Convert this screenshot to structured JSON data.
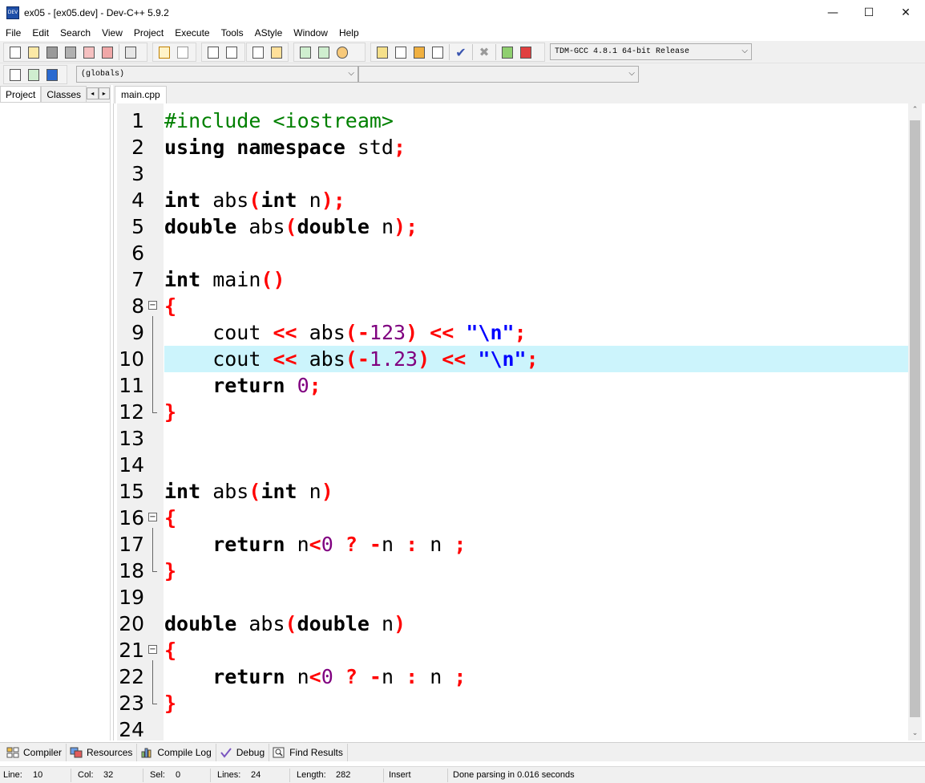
{
  "window": {
    "title": "ex05 - [ex05.dev] - Dev-C++ 5.9.2",
    "icon_label": "DEV",
    "minimize_glyph": "—",
    "maximize_glyph": "☐",
    "close_glyph": "✕"
  },
  "menu": [
    "File",
    "Edit",
    "Search",
    "View",
    "Project",
    "Execute",
    "Tools",
    "AStyle",
    "Window",
    "Help"
  ],
  "toolbar": {
    "compiler_select": "TDM-GCC 4.8.1 64-bit Release",
    "scope_select": "(globals)",
    "member_select": ""
  },
  "left_panel": {
    "tabs": [
      "Project",
      "Classes"
    ],
    "arrow_left": "◂",
    "arrow_right": "▸"
  },
  "editor": {
    "tab": "main.cpp",
    "highlighted_line": 10,
    "lines": [
      {
        "n": "1",
        "tokens": [
          {
            "t": "#include <iostream>",
            "c": "pp"
          }
        ]
      },
      {
        "n": "2",
        "tokens": [
          {
            "t": "using namespace",
            "c": "kw"
          },
          {
            "t": " std",
            "c": ""
          },
          {
            "t": ";",
            "c": "sym"
          }
        ]
      },
      {
        "n": "3",
        "tokens": []
      },
      {
        "n": "4",
        "tokens": [
          {
            "t": "int",
            "c": "kw"
          },
          {
            "t": " abs",
            "c": ""
          },
          {
            "t": "(",
            "c": "sym"
          },
          {
            "t": "int",
            "c": "kw"
          },
          {
            "t": " n",
            "c": ""
          },
          {
            "t": ");",
            "c": "sym"
          }
        ]
      },
      {
        "n": "5",
        "tokens": [
          {
            "t": "double",
            "c": "kw"
          },
          {
            "t": " abs",
            "c": ""
          },
          {
            "t": "(",
            "c": "sym"
          },
          {
            "t": "double",
            "c": "kw"
          },
          {
            "t": " n",
            "c": ""
          },
          {
            "t": ");",
            "c": "sym"
          }
        ]
      },
      {
        "n": "6",
        "tokens": []
      },
      {
        "n": "7",
        "tokens": [
          {
            "t": "int",
            "c": "kw"
          },
          {
            "t": " main",
            "c": ""
          },
          {
            "t": "()",
            "c": "sym"
          }
        ]
      },
      {
        "n": "8",
        "tokens": [
          {
            "t": "{",
            "c": "sym"
          }
        ]
      },
      {
        "n": "9",
        "tokens": [
          {
            "t": "    cout ",
            "c": ""
          },
          {
            "t": "<<",
            "c": "sym"
          },
          {
            "t": " abs",
            "c": ""
          },
          {
            "t": "(-",
            "c": "sym"
          },
          {
            "t": "123",
            "c": "num"
          },
          {
            "t": ") <<",
            "c": "sym"
          },
          {
            "t": " ",
            "c": ""
          },
          {
            "t": "\"\\n\"",
            "c": "str"
          },
          {
            "t": ";",
            "c": "sym"
          }
        ]
      },
      {
        "n": "10",
        "tokens": [
          {
            "t": "    cout ",
            "c": ""
          },
          {
            "t": "<<",
            "c": "sym"
          },
          {
            "t": " abs",
            "c": ""
          },
          {
            "t": "(-",
            "c": "sym"
          },
          {
            "t": "1.23",
            "c": "num"
          },
          {
            "t": ") <<",
            "c": "sym"
          },
          {
            "t": " ",
            "c": ""
          },
          {
            "t": "\"\\n\"",
            "c": "str"
          },
          {
            "t": ";",
            "c": "sym"
          }
        ]
      },
      {
        "n": "11",
        "tokens": [
          {
            "t": "    ",
            "c": ""
          },
          {
            "t": "return",
            "c": "kw"
          },
          {
            "t": " ",
            "c": ""
          },
          {
            "t": "0",
            "c": "num"
          },
          {
            "t": ";",
            "c": "sym"
          }
        ]
      },
      {
        "n": "12",
        "tokens": [
          {
            "t": "}",
            "c": "sym"
          }
        ]
      },
      {
        "n": "13",
        "tokens": []
      },
      {
        "n": "14",
        "tokens": []
      },
      {
        "n": "15",
        "tokens": [
          {
            "t": "int",
            "c": "kw"
          },
          {
            "t": " abs",
            "c": ""
          },
          {
            "t": "(",
            "c": "sym"
          },
          {
            "t": "int",
            "c": "kw"
          },
          {
            "t": " n",
            "c": ""
          },
          {
            "t": ")",
            "c": "sym"
          }
        ]
      },
      {
        "n": "16",
        "tokens": [
          {
            "t": "{",
            "c": "sym"
          }
        ]
      },
      {
        "n": "17",
        "tokens": [
          {
            "t": "    ",
            "c": ""
          },
          {
            "t": "return",
            "c": "kw"
          },
          {
            "t": " n",
            "c": ""
          },
          {
            "t": "<",
            "c": "sym"
          },
          {
            "t": "0",
            "c": "num"
          },
          {
            "t": " ? -",
            "c": "sym"
          },
          {
            "t": "n ",
            "c": ""
          },
          {
            "t": ":",
            "c": "sym"
          },
          {
            "t": " n ",
            "c": ""
          },
          {
            "t": ";",
            "c": "sym"
          }
        ]
      },
      {
        "n": "18",
        "tokens": [
          {
            "t": "}",
            "c": "sym"
          }
        ]
      },
      {
        "n": "19",
        "tokens": []
      },
      {
        "n": "20",
        "tokens": [
          {
            "t": "double",
            "c": "kw"
          },
          {
            "t": " abs",
            "c": ""
          },
          {
            "t": "(",
            "c": "sym"
          },
          {
            "t": "double",
            "c": "kw"
          },
          {
            "t": " n",
            "c": ""
          },
          {
            "t": ")",
            "c": "sym"
          }
        ]
      },
      {
        "n": "21",
        "tokens": [
          {
            "t": "{",
            "c": "sym"
          }
        ]
      },
      {
        "n": "22",
        "tokens": [
          {
            "t": "    ",
            "c": ""
          },
          {
            "t": "return",
            "c": "kw"
          },
          {
            "t": " n",
            "c": ""
          },
          {
            "t": "<",
            "c": "sym"
          },
          {
            "t": "0",
            "c": "num"
          },
          {
            "t": " ? -",
            "c": "sym"
          },
          {
            "t": "n ",
            "c": ""
          },
          {
            "t": ":",
            "c": "sym"
          },
          {
            "t": " n ",
            "c": ""
          },
          {
            "t": ";",
            "c": "sym"
          }
        ]
      },
      {
        "n": "23",
        "tokens": [
          {
            "t": "}",
            "c": "sym"
          }
        ]
      },
      {
        "n": "24",
        "tokens": []
      }
    ]
  },
  "bottom_tabs": [
    "Compiler",
    "Resources",
    "Compile Log",
    "Debug",
    "Find Results"
  ],
  "status": {
    "line_label": "Line:",
    "line_value": "10",
    "col_label": "Col:",
    "col_value": "32",
    "sel_label": "Sel:",
    "sel_value": "0",
    "lines_label": "Lines:",
    "lines_value": "24",
    "length_label": "Length:",
    "length_value": "282",
    "mode": "Insert",
    "message": "Done parsing in 0.016 seconds"
  },
  "colors": {
    "keyword": "#000000",
    "preprocessor": "#008000",
    "symbol": "#ff0000",
    "number": "#800080",
    "string": "#0000ff",
    "current_line": "#ccf4fc"
  }
}
